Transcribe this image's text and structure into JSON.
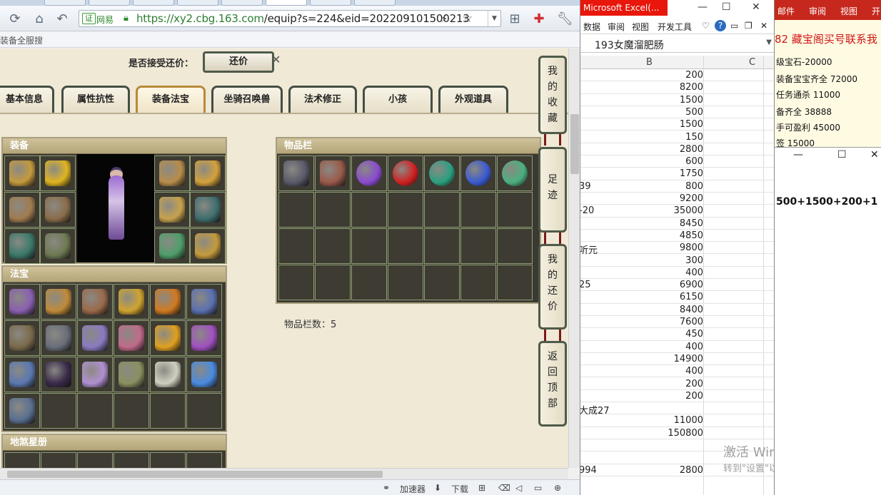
{
  "browser": {
    "url_host": "https://xy2.cbg.163.com",
    "url_path": "/equip?s=224&eid=202209101500213",
    "cert_label": "证",
    "site_label": "网易",
    "bookmark": "装备全服搜"
  },
  "page": {
    "bargain_label": "是否接受还价：",
    "bargain_button": "还价",
    "tabs": [
      "基本信息",
      "属性抗性",
      "装备法宝",
      "坐骑召唤兽",
      "法术修正",
      "小孩",
      "外观道具"
    ],
    "active_tab": "装备法宝",
    "equip_panel_title": "装备",
    "fabao_panel_title": "法宝",
    "disha_panel_title": "地煞星册",
    "inventory_panel_title": "物品栏",
    "inventory_count": "物品栏数：5",
    "side_buttons": [
      "我的收藏",
      "足迹",
      "我的还价",
      "返回顶部"
    ],
    "equip_colors": [
      "#c49a3c",
      "#e0b420",
      "#b88d4a",
      "#d3a13b",
      "#a07b4e",
      "#8a6d4a",
      "#c7a24d",
      "#3f6e6e",
      "#3a7a6a",
      "#6e7a52",
      "#4e9e6a"
    ],
    "fabao_colors": [
      "#8a5fb0",
      "#c08a3a",
      "#9a6a4a",
      "#d0a430",
      "#d07a20",
      "#5a70b0",
      "#7a6a4a",
      "#6a6e7a",
      "#8a7ac0",
      "#c06a8a",
      "#e0a020",
      "#a050c0",
      "#5a78b0",
      "#3a2a4a",
      "#b090d0",
      "#8a9060",
      "#d0d0c0",
      "#4a8ae0",
      "#5a7090"
    ],
    "inventory_colors": [
      "#5a5a6a",
      "#9a5a4a",
      "#8a4ad0",
      "#d02020",
      "#2aa080",
      "#3a5ad0",
      "#4ab080"
    ]
  },
  "statusbar": {
    "accelerator": "加速器",
    "download": "下载"
  },
  "excel": {
    "title": "Microsoft Excel(...",
    "ribbon_tabs": [
      "数据",
      "审阅",
      "视图",
      "开发工具"
    ],
    "formula_value": "193女魔溜肥肠",
    "col_b": "B",
    "col_c": "C",
    "rows": [
      {
        "a": "",
        "b": "200"
      },
      {
        "a": "",
        "b": "8200"
      },
      {
        "a": "",
        "b": "1500"
      },
      {
        "a": "",
        "b": "500"
      },
      {
        "a": "",
        "b": "1500"
      },
      {
        "a": "",
        "b": "150"
      },
      {
        "a": "",
        "b": "2800"
      },
      {
        "a": "",
        "b": "600"
      },
      {
        "a": "",
        "b": "1750"
      },
      {
        "a": "39",
        "b": "800"
      },
      {
        "a": "",
        "b": "9200"
      },
      {
        "a": "-20",
        "b": "35000"
      },
      {
        "a": "",
        "b": "8450"
      },
      {
        "a": "",
        "b": "4850"
      },
      {
        "a": "听元",
        "b": "9800"
      },
      {
        "a": "",
        "b": "300"
      },
      {
        "a": "",
        "b": "400"
      },
      {
        "a": "25",
        "b": "6900"
      },
      {
        "a": "",
        "b": "6150"
      },
      {
        "a": "",
        "b": "8400"
      },
      {
        "a": "",
        "b": "7600"
      },
      {
        "a": "",
        "b": "450"
      },
      {
        "a": "",
        "b": "400"
      },
      {
        "a": "",
        "b": "14900"
      },
      {
        "a": "",
        "b": "400"
      },
      {
        "a": "",
        "b": "200"
      },
      {
        "a": "",
        "b": "200"
      },
      {
        "a": "大成27",
        "b": ""
      },
      {
        "a": "",
        "b": "11000"
      },
      {
        "a": "",
        "b": "150800"
      },
      {
        "a": "",
        "b": ""
      },
      {
        "a": "",
        "b": ""
      },
      {
        "a": "994",
        "b": "2800"
      }
    ],
    "watermark_title": "激活 Windows",
    "watermark_sub": "转到\"设置\"以激活 Windows。"
  },
  "doc": {
    "ribbon_tabs": [
      "邮件",
      "审阅",
      "视图",
      "开"
    ],
    "title": "82 藏宝阁买号联系我",
    "lines": [
      "级宝石-20000",
      "装备宝宝齐全 72000",
      "任务通杀 11000",
      "备齐全 38888",
      "手可盈利 45000",
      "签 15000"
    ],
    "calc_expr": "500+1500+200+1"
  }
}
